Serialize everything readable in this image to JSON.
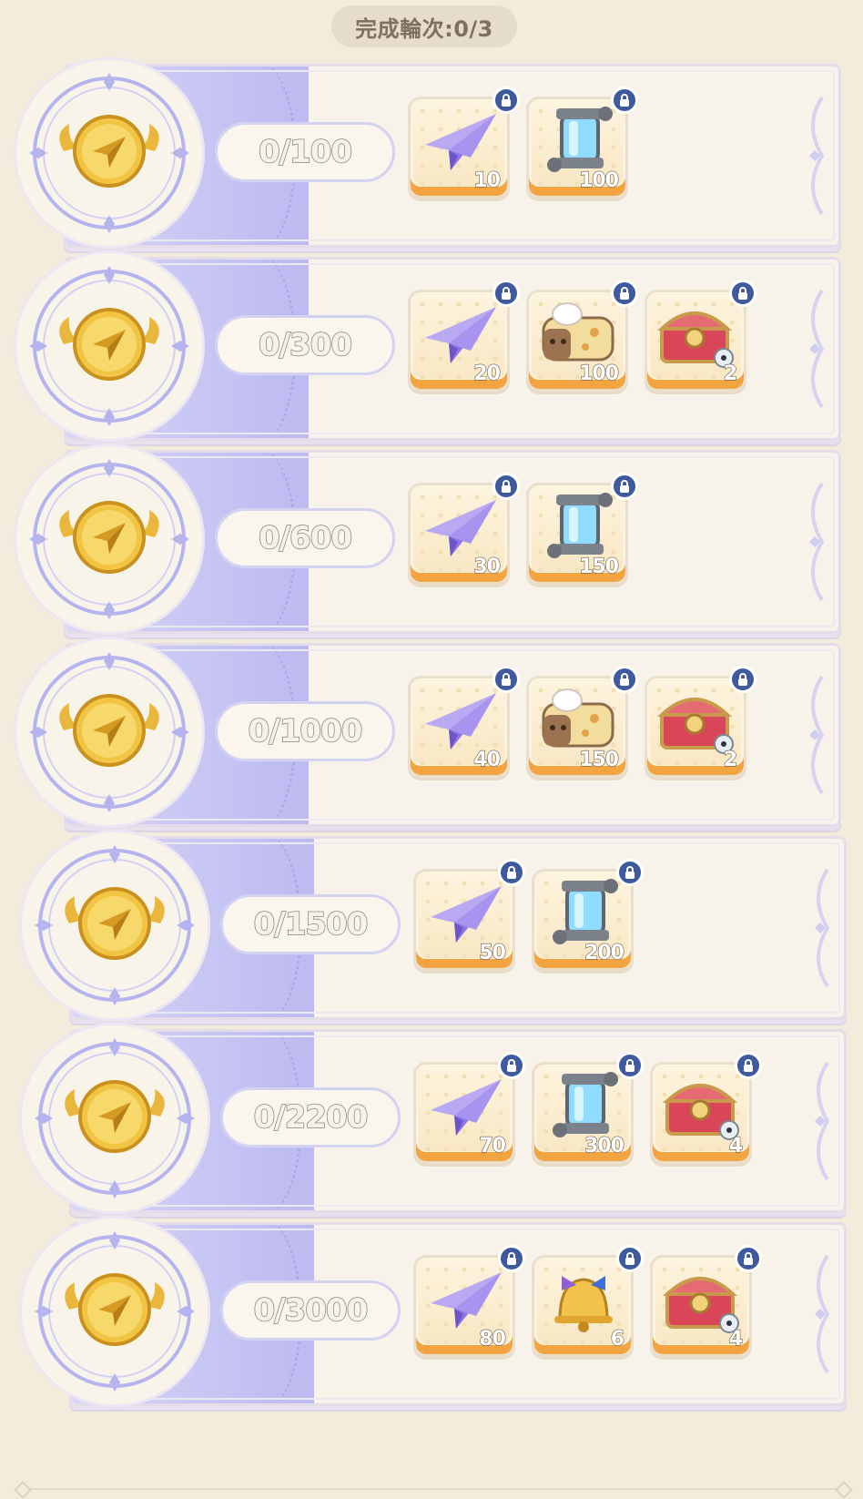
{
  "header": {
    "round_label": "完成輪次:0/3"
  },
  "colors": {
    "band": "#c7c6f3",
    "card_bg": "#f8f3ea",
    "reward_bottom": "#f1a440",
    "lock_bg": "#3f5a9e"
  },
  "rows": [
    {
      "progress": "0/100",
      "rewards": [
        {
          "icon": "paper-plane",
          "qty": "10"
        },
        {
          "icon": "blue-crystal-capsule",
          "qty": "100"
        }
      ]
    },
    {
      "progress": "0/300",
      "rewards": [
        {
          "icon": "paper-plane",
          "qty": "20"
        },
        {
          "icon": "bread-loaf",
          "qty": "100"
        },
        {
          "icon": "treasure-chest",
          "qty": "2"
        }
      ]
    },
    {
      "progress": "0/600",
      "rewards": [
        {
          "icon": "paper-plane",
          "qty": "30"
        },
        {
          "icon": "blue-crystal-capsule",
          "qty": "150"
        }
      ]
    },
    {
      "progress": "0/1000",
      "rewards": [
        {
          "icon": "paper-plane",
          "qty": "40"
        },
        {
          "icon": "bread-loaf",
          "qty": "150"
        },
        {
          "icon": "treasure-chest",
          "qty": "2"
        }
      ]
    },
    {
      "progress": "0/1500",
      "rewards": [
        {
          "icon": "paper-plane",
          "qty": "50"
        },
        {
          "icon": "blue-crystal-capsule",
          "qty": "200"
        }
      ]
    },
    {
      "progress": "0/2200",
      "rewards": [
        {
          "icon": "paper-plane",
          "qty": "70"
        },
        {
          "icon": "blue-crystal-capsule",
          "qty": "300"
        },
        {
          "icon": "treasure-chest",
          "qty": "4"
        }
      ]
    },
    {
      "progress": "0/3000",
      "rewards": [
        {
          "icon": "paper-plane",
          "qty": "80"
        },
        {
          "icon": "golden-bell",
          "qty": "6"
        },
        {
          "icon": "treasure-chest",
          "qty": "4"
        }
      ]
    }
  ]
}
